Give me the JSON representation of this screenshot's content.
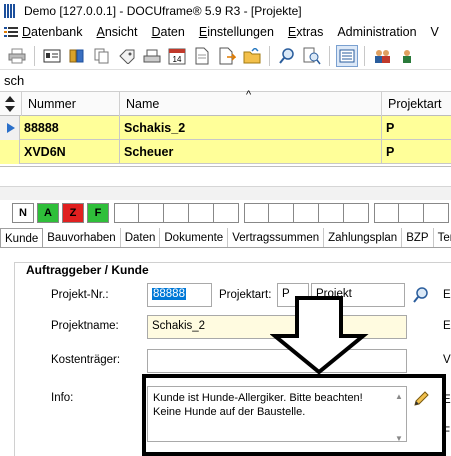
{
  "window": {
    "title": "Demo [127.0.0.1] - DOCUframe® 5.9 R3 - [Projekte]"
  },
  "menu": {
    "items": [
      {
        "label": "Datenbank",
        "underline": "D"
      },
      {
        "label": "Ansicht",
        "underline": "A"
      },
      {
        "label": "Daten",
        "underline": "D"
      },
      {
        "label": "Einstellungen",
        "underline": "E"
      },
      {
        "label": "Extras",
        "underline": "E"
      },
      {
        "label": "Administration",
        "underline": ""
      },
      {
        "label": "V",
        "underline": ""
      }
    ]
  },
  "toolbar": {
    "icons": [
      "menu-icon",
      "print-icon",
      "record-icon",
      "open-book-icon",
      "copy-icon",
      "tag-icon",
      "scanner-icon",
      "calendar-icon",
      "document-icon",
      "document-icon",
      "export-icon",
      "search-icon",
      "search-doc-icon",
      "view-list-icon",
      "users-icon",
      "user-icon"
    ],
    "calendar_day": "14"
  },
  "search": {
    "value": "sch"
  },
  "grid": {
    "columns": [
      "Nummer",
      "Name",
      "Projektart"
    ],
    "rows": [
      {
        "nummer": "88888",
        "name": "Schakis_2",
        "projektart": "P"
      },
      {
        "nummer": "XVD6N",
        "name": "Scheuer",
        "projektart": "P"
      }
    ]
  },
  "status_strip": {
    "boxes": [
      {
        "label": "N",
        "color": "#ffffff"
      },
      {
        "label": "A",
        "color": "#2fbf3a"
      },
      {
        "label": "Z",
        "color": "#e02020"
      },
      {
        "label": "F",
        "color": "#2fbf3a"
      }
    ]
  },
  "tabs": [
    "Kunde",
    "Bauvorhaben",
    "Daten",
    "Dokumente",
    "Vertragssummen",
    "Zahlungsplan",
    "BZP",
    "Termin"
  ],
  "form": {
    "group_title": "Auftraggeber / Kunde",
    "projekt_nr_label": "Projekt-Nr.:",
    "projekt_nr_value": "88888",
    "projektart_label": "Projektart:",
    "projektart_code": "P",
    "projektart_value": "Projekt",
    "projektname_label": "Projektname:",
    "projektname_value": "Schakis_2",
    "kostentraeger_label": "Kostenträger:",
    "kostentraeger_value": "",
    "info_label": "Info:",
    "info_value": "Kunde ist Hunde-Allergiker. Bitte beachten! Keine Hunde auf der Baustelle.",
    "right_letters": [
      "E",
      "E",
      "V",
      "E",
      "F"
    ]
  },
  "colors": {
    "row_highlight": "#ffff99",
    "field_yellow": "#fffbe0",
    "selection": "#0078d7"
  }
}
